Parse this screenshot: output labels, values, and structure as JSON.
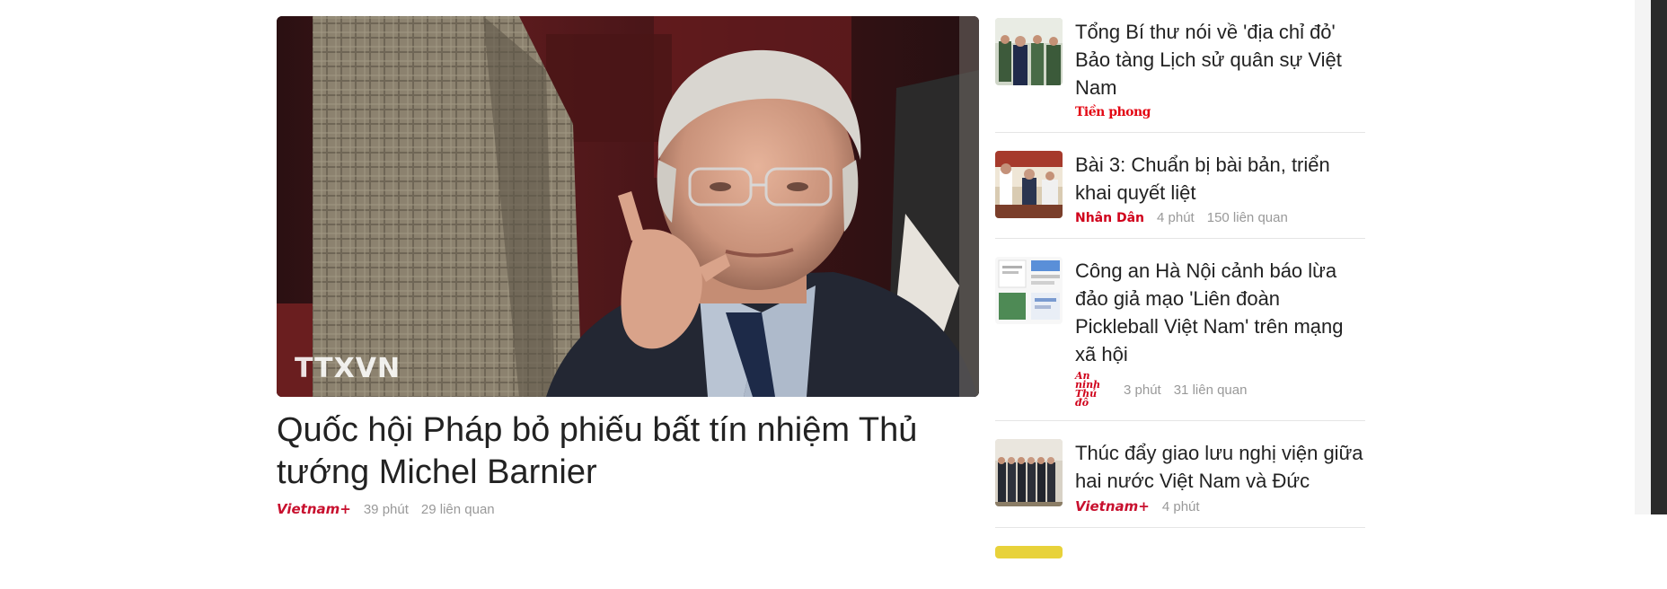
{
  "featured": {
    "image_watermark": "TTXVN",
    "title": "Quốc hội Pháp bỏ phiếu bất tín nhiệm Thủ tướng Michel Barnier",
    "source": "Vietnam+",
    "time": "39 phút",
    "related": "29 liên quan"
  },
  "side_items": [
    {
      "title": "Tổng Bí thư nói về 'địa chỉ đỏ' Bảo tàng Lịch sử quân sự Việt Nam",
      "source": "Tiền phong"
    },
    {
      "title": "Bài 3: Chuẩn bị bài bản, triển khai quyết liệt",
      "source": "Nhân Dân",
      "time": "4 phút",
      "related": "150 liên quan"
    },
    {
      "title": "Công an Hà Nội cảnh báo lừa đảo giả mạo 'Liên đoàn Pickleball Việt Nam' trên mạng xã hội",
      "source": "An ninh Thủ đô",
      "time": "3 phút",
      "related": "31 liên quan"
    },
    {
      "title": "Thúc đẩy giao lưu nghị viện giữa hai nước Việt Nam và Đức",
      "source": "Vietnam+",
      "time": "4 phút"
    }
  ],
  "colors": {
    "source_red": "#c8102e",
    "meta_gray": "#999999",
    "title_text": "#222222"
  }
}
